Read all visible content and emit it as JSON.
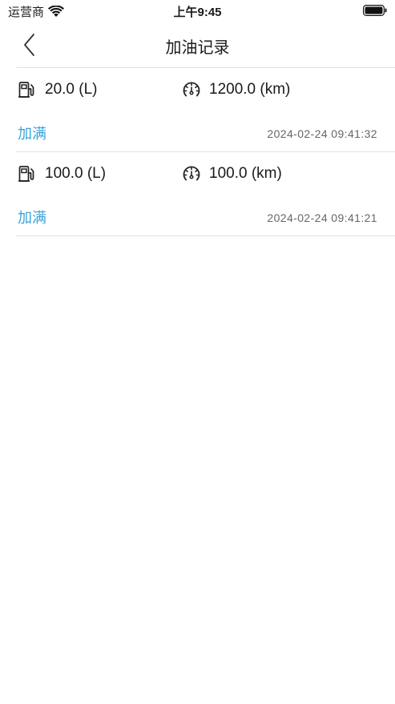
{
  "status_bar": {
    "carrier": "运营商",
    "time": "上午9:45",
    "wifi_icon": "wifi-icon",
    "battery_icon": "battery-icon"
  },
  "nav": {
    "title": "加油记录",
    "back_icon": "chevron-left-icon"
  },
  "records": [
    {
      "fuel": "20.0 (L)",
      "mileage": "1200.0 (km)",
      "type": "加满",
      "time": "2024-02-24 09:41:32"
    },
    {
      "fuel": "100.0 (L)",
      "mileage": "100.0 (km)",
      "type": "加满",
      "time": "2024-02-24 09:41:21"
    }
  ],
  "colors": {
    "accent": "#3ba3dc",
    "text": "#1a1a1a",
    "muted": "#666666",
    "divider": "#e2e2e2"
  }
}
